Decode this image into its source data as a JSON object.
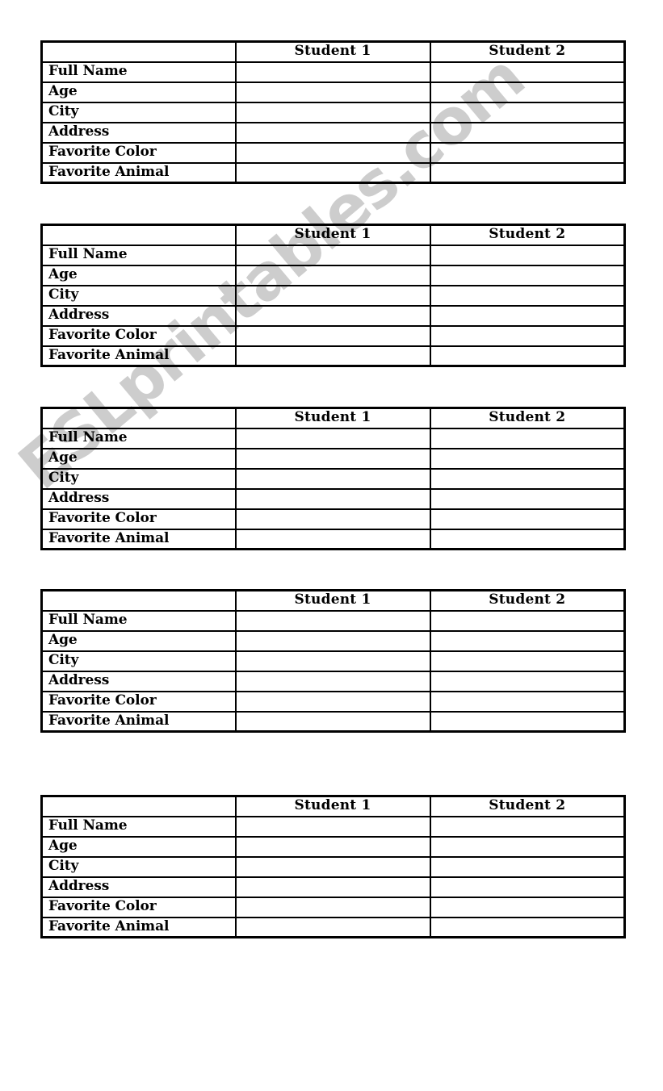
{
  "page": {
    "type": "printable-worksheet",
    "background_color": "#ffffff",
    "ink_color": "#000000"
  },
  "watermark": {
    "text": "ESLprintables.com",
    "color": "#c9c9c9",
    "rotation_degrees": -40
  },
  "table_template": {
    "columns": [
      {
        "key": "label",
        "header": ""
      },
      {
        "key": "student_1",
        "header": "Student 1"
      },
      {
        "key": "student_2",
        "header": "Student 2"
      }
    ],
    "rows": [
      {
        "label": "Full Name",
        "student_1": "",
        "student_2": ""
      },
      {
        "label": "Age",
        "student_1": "",
        "student_2": ""
      },
      {
        "label": "City",
        "student_1": "",
        "student_2": ""
      },
      {
        "label": "Address",
        "student_1": "",
        "student_2": ""
      },
      {
        "label": "Favorite Color",
        "student_1": "",
        "student_2": ""
      },
      {
        "label": "Favorite Animal",
        "student_1": "",
        "student_2": ""
      }
    ]
  },
  "tables": [
    {
      "index": 1,
      "headers": {
        "blank": "",
        "student_1": "Student 1",
        "student_2": "Student 2"
      },
      "rows": [
        {
          "label": "Full Name",
          "student_1": "",
          "student_2": ""
        },
        {
          "label": "Age",
          "student_1": "",
          "student_2": ""
        },
        {
          "label": "City",
          "student_1": "",
          "student_2": ""
        },
        {
          "label": "Address",
          "student_1": "",
          "student_2": ""
        },
        {
          "label": "Favorite Color",
          "student_1": "",
          "student_2": ""
        },
        {
          "label": "Favorite Animal",
          "student_1": "",
          "student_2": ""
        }
      ]
    },
    {
      "index": 2,
      "headers": {
        "blank": "",
        "student_1": "Student 1",
        "student_2": "Student 2"
      },
      "rows": [
        {
          "label": "Full Name",
          "student_1": "",
          "student_2": ""
        },
        {
          "label": "Age",
          "student_1": "",
          "student_2": ""
        },
        {
          "label": "City",
          "student_1": "",
          "student_2": ""
        },
        {
          "label": "Address",
          "student_1": "",
          "student_2": ""
        },
        {
          "label": "Favorite Color",
          "student_1": "",
          "student_2": ""
        },
        {
          "label": "Favorite Animal",
          "student_1": "",
          "student_2": ""
        }
      ]
    },
    {
      "index": 3,
      "headers": {
        "blank": "",
        "student_1": "Student 1",
        "student_2": "Student 2"
      },
      "rows": [
        {
          "label": "Full Name",
          "student_1": "",
          "student_2": ""
        },
        {
          "label": "Age",
          "student_1": "",
          "student_2": ""
        },
        {
          "label": "City",
          "student_1": "",
          "student_2": ""
        },
        {
          "label": "Address",
          "student_1": "",
          "student_2": ""
        },
        {
          "label": "Favorite Color",
          "student_1": "",
          "student_2": ""
        },
        {
          "label": "Favorite Animal",
          "student_1": "",
          "student_2": ""
        }
      ]
    },
    {
      "index": 4,
      "headers": {
        "blank": "",
        "student_1": "Student 1",
        "student_2": "Student 2"
      },
      "rows": [
        {
          "label": "Full Name",
          "student_1": "",
          "student_2": ""
        },
        {
          "label": "Age",
          "student_1": "",
          "student_2": ""
        },
        {
          "label": "City",
          "student_1": "",
          "student_2": ""
        },
        {
          "label": "Address",
          "student_1": "",
          "student_2": ""
        },
        {
          "label": "Favorite Color",
          "student_1": "",
          "student_2": ""
        },
        {
          "label": "Favorite Animal",
          "student_1": "",
          "student_2": ""
        }
      ]
    },
    {
      "index": 5,
      "headers": {
        "blank": "",
        "student_1": "Student 1",
        "student_2": "Student 2"
      },
      "rows": [
        {
          "label": "Full Name",
          "student_1": "",
          "student_2": ""
        },
        {
          "label": "Age",
          "student_1": "",
          "student_2": ""
        },
        {
          "label": "City",
          "student_1": "",
          "student_2": ""
        },
        {
          "label": "Address",
          "student_1": "",
          "student_2": ""
        },
        {
          "label": "Favorite Color",
          "student_1": "",
          "student_2": ""
        },
        {
          "label": "Favorite Animal",
          "student_1": "",
          "student_2": ""
        }
      ]
    }
  ]
}
